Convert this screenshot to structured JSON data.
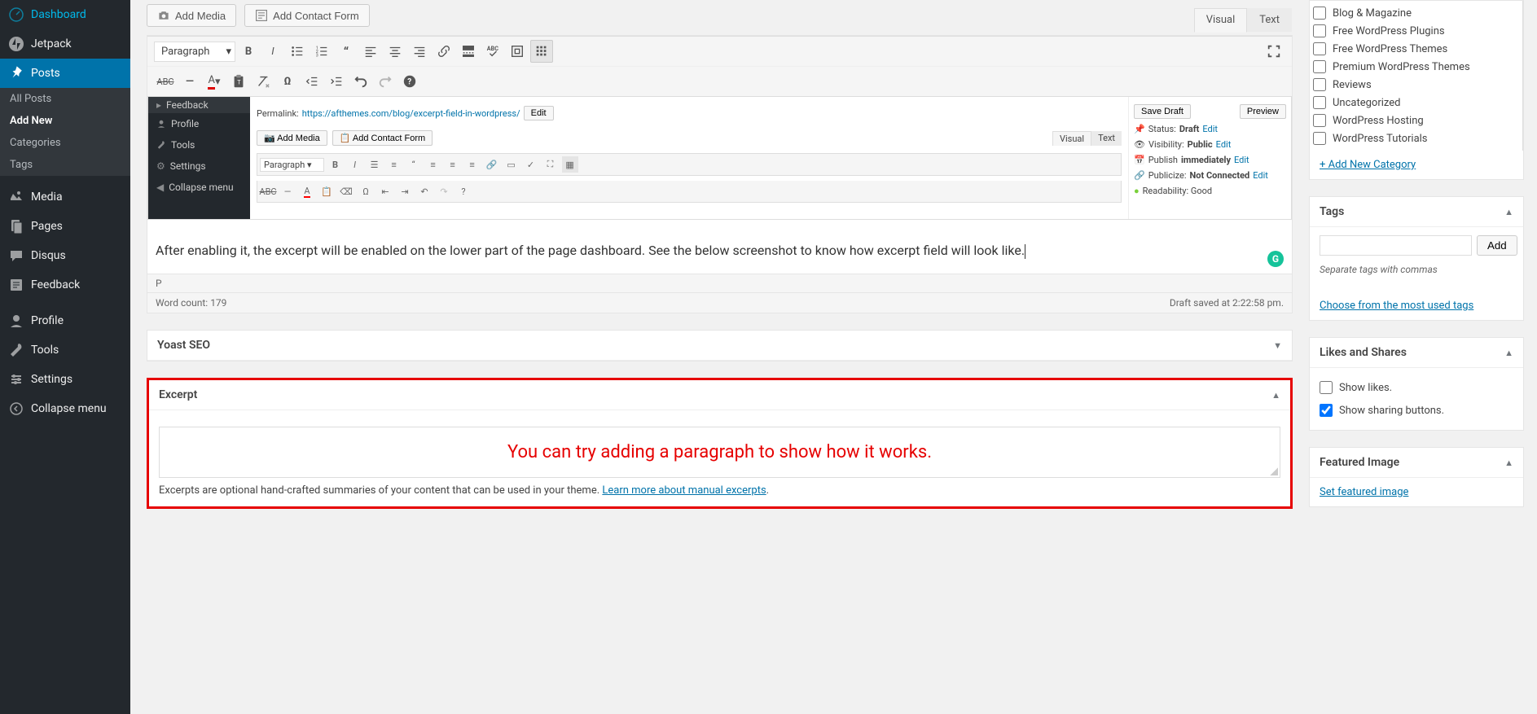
{
  "sidebar": {
    "items": [
      {
        "label": "Dashboard",
        "icon": "dashboard"
      },
      {
        "label": "Jetpack",
        "icon": "jetpack"
      },
      {
        "label": "Posts",
        "icon": "pin",
        "active": true,
        "sub": [
          {
            "label": "All Posts"
          },
          {
            "label": "Add New",
            "current": true
          },
          {
            "label": "Categories"
          },
          {
            "label": "Tags"
          }
        ]
      },
      {
        "label": "Media",
        "icon": "media"
      },
      {
        "label": "Pages",
        "icon": "pages"
      },
      {
        "label": "Disqus",
        "icon": "comment"
      },
      {
        "label": "Feedback",
        "icon": "feedback"
      },
      {
        "label": "Profile",
        "icon": "user"
      },
      {
        "label": "Tools",
        "icon": "tools"
      },
      {
        "label": "Settings",
        "icon": "settings"
      },
      {
        "label": "Collapse menu",
        "icon": "collapse"
      }
    ]
  },
  "topButtons": {
    "addMedia": "Add Media",
    "addContactForm": "Add Contact Form"
  },
  "editorTabs": {
    "visual": "Visual",
    "text": "Text"
  },
  "toolbarSelect": "Paragraph",
  "innerScreenshot": {
    "sidebarItems": [
      "Profile",
      "Tools",
      "Settings",
      "Collapse menu"
    ],
    "sidebarTop": "Feedback",
    "permalinkLabel": "Permalink:",
    "permalinkBase": "https://afthemes.com/blog/",
    "permalinkSlug": "excerpt-field-in-wordpress/",
    "permalinkEdit": "Edit",
    "addMedia": "Add Media",
    "addContactForm": "Add Contact Form",
    "tabs": {
      "visual": "Visual",
      "text": "Text"
    },
    "select": "Paragraph",
    "right": {
      "saveDraft": "Save Draft",
      "preview": "Preview",
      "statusLabel": "Status:",
      "statusValue": "Draft",
      "statusEdit": "Edit",
      "visibilityLabel": "Visibility:",
      "visibilityValue": "Public",
      "visibilityEdit": "Edit",
      "publishLabel": "Publish",
      "publishValue": "immediately",
      "publishEdit": "Edit",
      "publicizeLabel": "Publicize:",
      "publicizeValue": "Not Connected",
      "publicizeEdit": "Edit",
      "readability": "Readability: Good"
    }
  },
  "bodyText": "After enabling it, the excerpt will be enabled on the lower part of the page dashboard. See the below screenshot to know how excerpt field will look like.",
  "pPath": "P",
  "wordCountLabel": "Word count: ",
  "wordCountValue": "179",
  "draftSaved": "Draft saved at 2:22:58 pm.",
  "yoast": {
    "title": "Yoast SEO"
  },
  "excerpt": {
    "title": "Excerpt",
    "placeholder": "You can try adding a paragraph to show how it works.",
    "helpPrefix": "Excerpts are optional hand-crafted summaries of your content that can be used in your theme. ",
    "helpLink": "Learn more about manual excerpts",
    "helpSuffix": "."
  },
  "categories": {
    "items": [
      "Blog & Magazine",
      "Free WordPress Plugins",
      "Free WordPress Themes",
      "Premium WordPress Themes",
      "Reviews",
      "Uncategorized",
      "WordPress Hosting",
      "WordPress Tutorials"
    ],
    "addNew": "+ Add New Category"
  },
  "tags": {
    "title": "Tags",
    "addBtn": "Add",
    "hint": "Separate tags with commas",
    "chooseLink": "Choose from the most used tags"
  },
  "likes": {
    "title": "Likes and Shares",
    "showLikes": "Show likes.",
    "showSharing": "Show sharing buttons."
  },
  "featured": {
    "title": "Featured Image",
    "link": "Set featured image"
  }
}
